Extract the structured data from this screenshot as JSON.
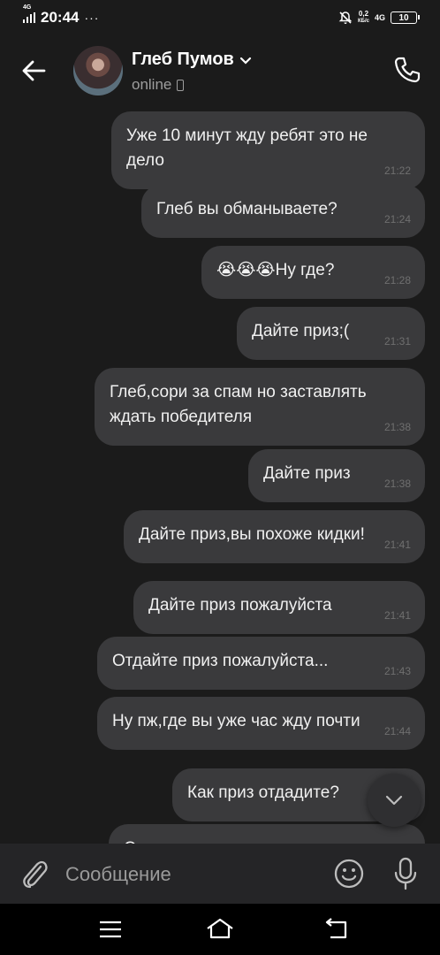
{
  "status_bar": {
    "network_tag": "4G",
    "time": "20:44",
    "dots": "···",
    "speed_value": "0,2",
    "speed_unit": "КБ/с",
    "network_right": "4G",
    "battery": "10"
  },
  "header": {
    "contact_name": "Глеб Пумов",
    "contact_status": "online"
  },
  "messages": [
    {
      "text": "Уже 10 минут жду ребят это не дело",
      "time": "21:22"
    },
    {
      "text": "Глеб вы обманываете?",
      "time": "21:24"
    },
    {
      "text": "😭😭😭Ну где?",
      "time": "21:28"
    },
    {
      "text": "Дайте приз;(",
      "time": "21:31"
    },
    {
      "text": "Глеб,сори за спам но заставлять ждать победителя",
      "time": "21:38"
    },
    {
      "text": "Дайте приз",
      "time": "21:38"
    },
    {
      "text": "Дайте приз,вы похоже кидки!",
      "time": "21:41"
    },
    {
      "text": "Дайте приз пожалуйста",
      "time": "21:41"
    },
    {
      "text": "Отдайте приз пожалуйста...",
      "time": "21:43"
    },
    {
      "text": "Ну пж,где вы уже  час жду почти",
      "time": "21:44"
    },
    {
      "text": "Как приз отдадите?",
      "time": ""
    },
    {
      "text": "Сор за спам ты не отвечал",
      "time": ""
    }
  ],
  "composer": {
    "placeholder": "Сообщение"
  },
  "colors": {
    "background": "#1b1b1b",
    "bubble": "#3a3a3c",
    "timestamp": "#6f6f6f"
  }
}
